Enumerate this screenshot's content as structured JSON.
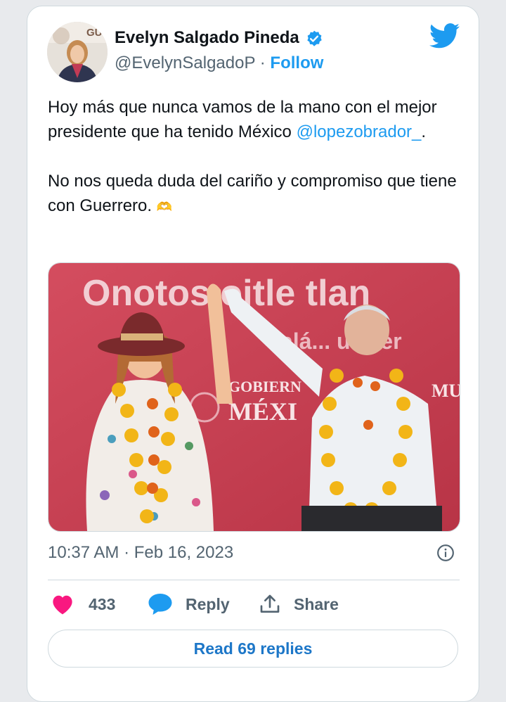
{
  "tweet": {
    "author_name": "Evelyn Salgado Pineda",
    "handle": "@EvelynSalgadoP",
    "separator": "·",
    "follow_label": "Follow",
    "text_line1": "Hoy más que nunca vamos de la mano con el mejor presidente que ha tenido México",
    "mention": "@lopezobrador_",
    "text_after_mention": ".",
    "text_para2": "No nos queda duda del cariño y compromiso que tiene con Guerrero.",
    "emoji": "🫶",
    "timestamp": "10:37 AM · Feb 16, 2023"
  },
  "image": {
    "banner_text": "Onotos ojtle tlan",
    "sub_text": "alá... uerrer",
    "gov_text_1": "GOBIERN",
    "gov_text_2": "MÉXI",
    "right_text": "MU",
    "avatar_text": "GU"
  },
  "actions": {
    "like_count": "433",
    "reply_label": "Reply",
    "share_label": "Share",
    "read_replies_label": "Read 69 replies"
  },
  "colors": {
    "twitter_blue": "#1d9bf0",
    "like_pink": "#f91880",
    "banner_red": "#d9485a"
  },
  "icons": [
    "verified-badge-icon",
    "twitter-bird-icon",
    "info-icon",
    "heart-icon",
    "reply-bubble-icon",
    "share-icon"
  ]
}
